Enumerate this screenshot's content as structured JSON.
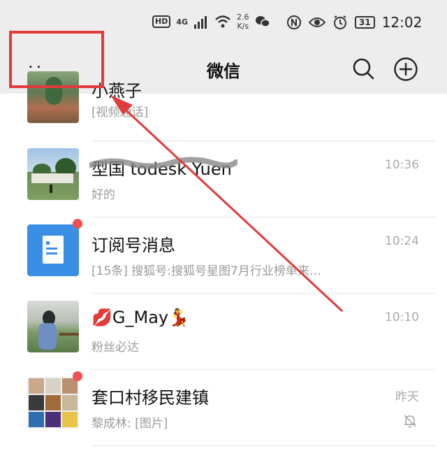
{
  "status_bar": {
    "hd": "HD",
    "network": "4G",
    "speed_value": "2.6",
    "speed_unit": "K/s",
    "battery": "31",
    "time": "12:02"
  },
  "header": {
    "more_label": "··",
    "title": "微信"
  },
  "chats": [
    {
      "name": "小燕子",
      "preview": "[视频通话]",
      "time": ""
    },
    {
      "name": "型国 todesk Yuen",
      "preview": "好的",
      "time": "10:36"
    },
    {
      "name": "订阅号消息",
      "preview": "[15条] 搜狐号:搜狐号星图7月行业榜单来…",
      "time": "10:24"
    },
    {
      "name": "💋G_May💃",
      "preview": "粉丝必达",
      "time": "10:10"
    },
    {
      "name": "套口村移民建镇",
      "preview": "黎成林: [图片]",
      "time": "昨天"
    }
  ],
  "colors": {
    "accent_red": "#e23b3b",
    "unread_dot": "#f05050",
    "subscription_blue": "#3a8ee6"
  }
}
